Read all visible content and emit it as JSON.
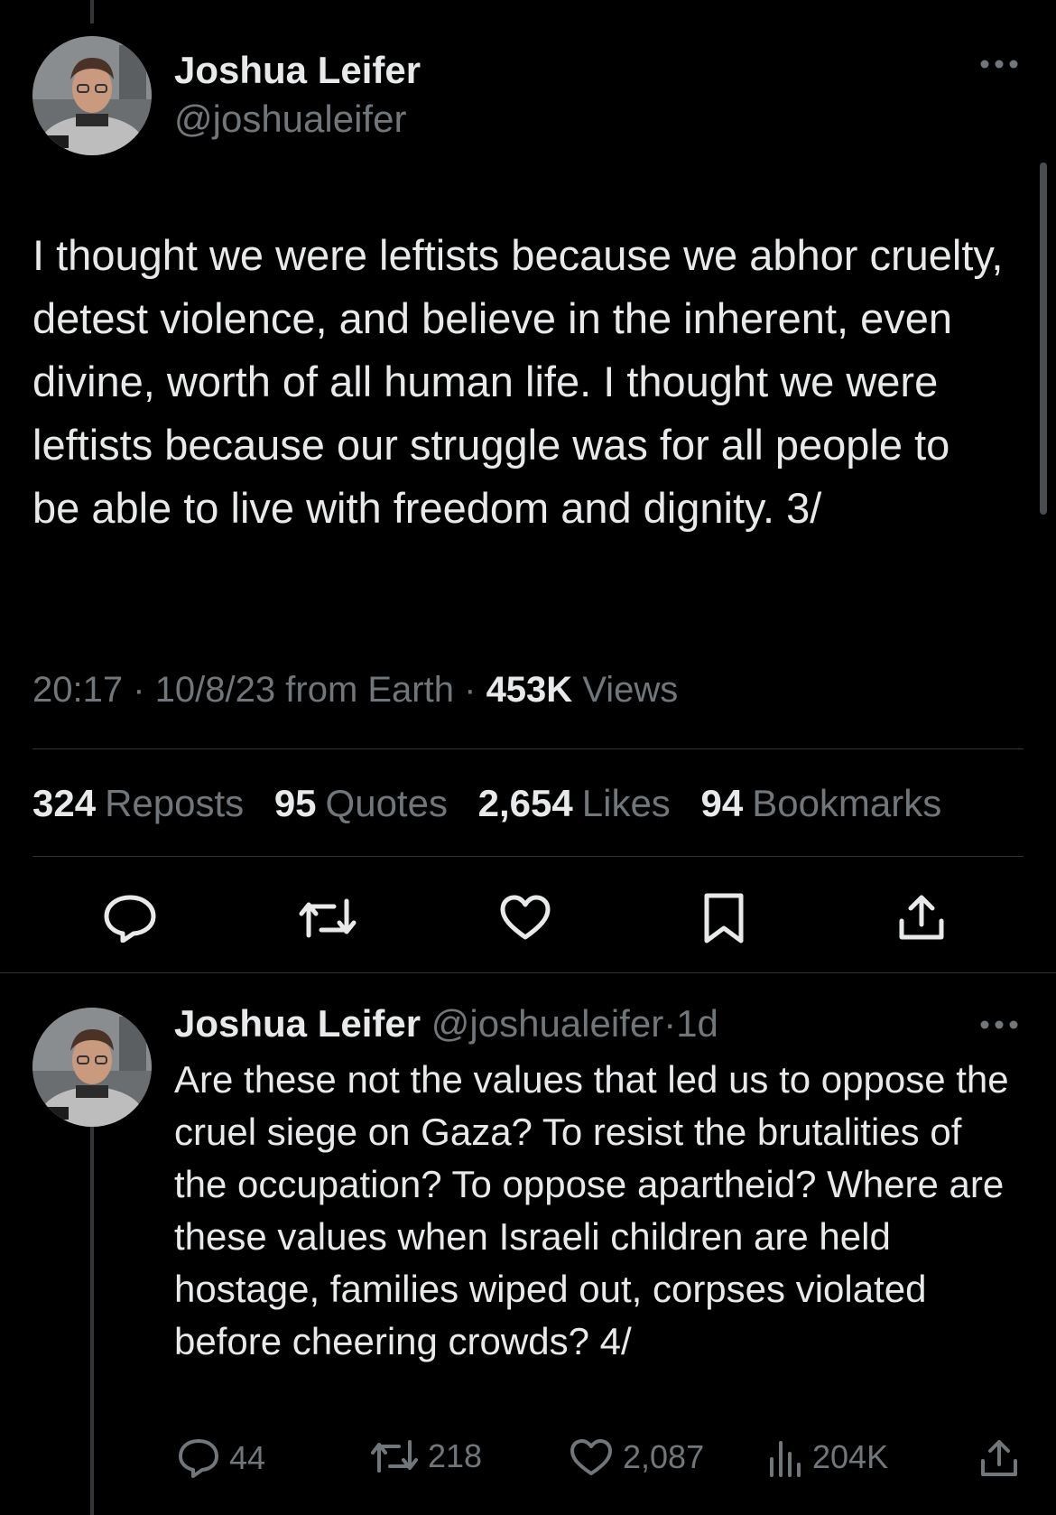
{
  "main_post": {
    "author_name": "Joshua Leifer",
    "author_handle": "@joshualeifer",
    "text": "I thought we were leftists because we abhor cruelty, detest violence, and believe in the inherent, even divine, worth of all human life. I thought we were leftists because our struggle was for all people to be able to live  with freedom and dignity. 3/",
    "time": "20:17",
    "date": "10/8/23 from Earth",
    "views_count": "453K",
    "views_label": "Views",
    "stats": [
      {
        "count": "324",
        "label": "Reposts"
      },
      {
        "count": "95",
        "label": "Quotes"
      },
      {
        "count": "2,654",
        "label": "Likes"
      },
      {
        "count": "94",
        "label": "Bookmarks"
      }
    ],
    "actions": [
      "reply-icon",
      "repost-icon",
      "like-icon",
      "bookmark-icon",
      "share-icon"
    ]
  },
  "reply_post": {
    "author_name": "Joshua Leifer",
    "author_handle": "@joshualeifer",
    "age": "1d",
    "text": "Are these not the values that led us to oppose the cruel siege on Gaza? To resist the brutalities of the occupation? To oppose apartheid? Where are these values when Israeli children are held hostage, families wiped out, corpses violated before cheering crowds? 4/",
    "replies": "44",
    "reposts": "218",
    "likes": "2,087",
    "views": "204K"
  },
  "colors": {
    "background": "#000000",
    "text": "#e7e9ea",
    "muted": "#71767b",
    "divider": "#2f3336"
  }
}
